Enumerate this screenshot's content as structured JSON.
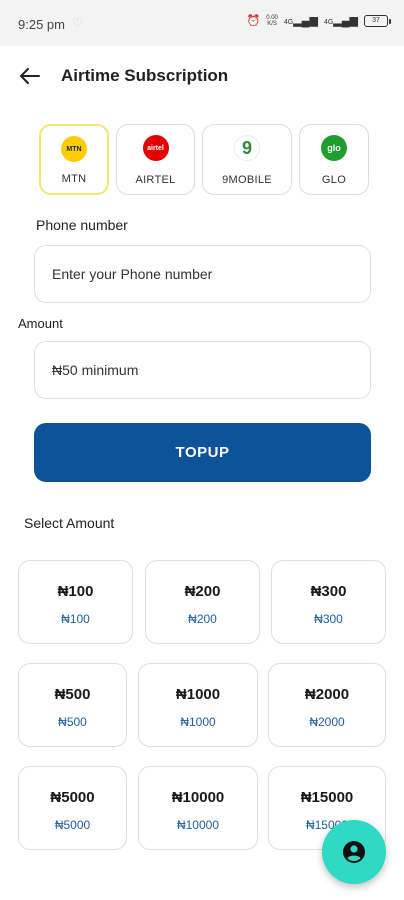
{
  "status_bar": {
    "time": "9:25 pm",
    "speed_top": "0.00",
    "speed_bottom": "K/S",
    "signal1": "4G",
    "signal2": "4G",
    "battery": "37"
  },
  "header": {
    "title": "Airtime Subscription",
    "back_icon": "arrow-left-icon"
  },
  "networks": [
    {
      "label": "MTN",
      "logo_text": "MTN",
      "logo_bg": "#ffcc00",
      "logo_fg": "#0b2a5e",
      "selected": true
    },
    {
      "label": "AIRTEL",
      "logo_text": "airtel",
      "logo_bg": "#e40000",
      "logo_fg": "#ffffff",
      "selected": false
    },
    {
      "label": "9MOBILE",
      "logo_text": "9",
      "logo_bg": "#ffffff",
      "logo_fg": "#2e8b3a",
      "selected": false
    },
    {
      "label": "GLO",
      "logo_text": "glo",
      "logo_bg": "#1f9d2f",
      "logo_fg": "#ffffff",
      "selected": false
    }
  ],
  "phone": {
    "label": "Phone number",
    "placeholder": "Enter your Phone number"
  },
  "amount": {
    "label": "Amount",
    "placeholder": "₦50 minimum"
  },
  "topup_label": "TOPUP",
  "select_amount_label": "Select Amount",
  "amounts": [
    {
      "main": "₦100",
      "sub": "₦100"
    },
    {
      "main": "₦200",
      "sub": "₦200"
    },
    {
      "main": "₦300",
      "sub": "₦300"
    },
    {
      "main": "₦500",
      "sub": "₦500"
    },
    {
      "main": "₦1000",
      "sub": "₦1000"
    },
    {
      "main": "₦2000",
      "sub": "₦2000"
    },
    {
      "main": "₦5000",
      "sub": "₦5000"
    },
    {
      "main": "₦10000",
      "sub": "₦10000"
    },
    {
      "main": "₦15000",
      "sub": "₦15000"
    }
  ],
  "fab_icon": "user-account-icon",
  "colors": {
    "primary": "#0e5399",
    "fab": "#2fd9c3",
    "selected_border": "#f2e66f",
    "amount_sub": "#1f5f9e"
  }
}
